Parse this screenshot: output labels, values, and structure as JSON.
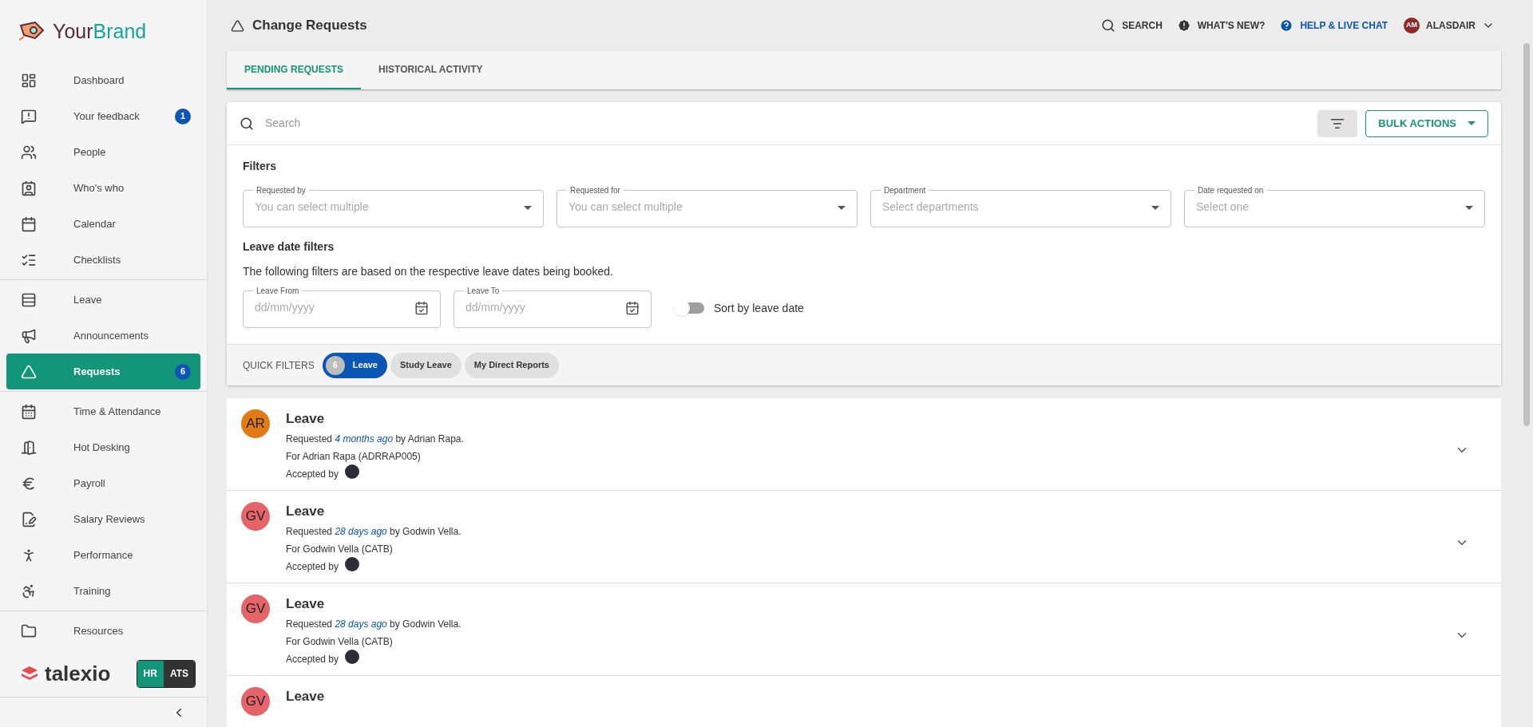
{
  "brand": {
    "prefix": "Your",
    "suffix": "Brand"
  },
  "sidebar": {
    "sections": [
      [
        {
          "label": "Dashboard",
          "selected": false
        },
        {
          "label": "Your feedback",
          "badge": "1",
          "selected": false
        },
        {
          "label": "People",
          "selected": false
        },
        {
          "label": "Who's who",
          "selected": false
        },
        {
          "label": "Calendar",
          "selected": false
        },
        {
          "label": "Checklists",
          "selected": false
        }
      ],
      [
        {
          "label": "Leave",
          "selected": false
        },
        {
          "label": "Announcements",
          "selected": false
        },
        {
          "label": "Requests",
          "badge": "6",
          "selected": true
        }
      ],
      [
        {
          "label": "Time & Attendance",
          "selected": false
        },
        {
          "label": "Hot Desking",
          "selected": false
        },
        {
          "label": "Payroll",
          "selected": false
        },
        {
          "label": "Salary Reviews",
          "selected": false
        },
        {
          "label": "Performance",
          "selected": false
        },
        {
          "label": "Training",
          "selected": false
        }
      ],
      [
        {
          "label": "Resources",
          "selected": false
        }
      ]
    ],
    "footer": {
      "logo": "talexio",
      "switch": [
        {
          "label": "HR",
          "selected": true
        },
        {
          "label": "ATS",
          "selected": false
        }
      ]
    }
  },
  "header": {
    "title": "Change Requests",
    "actions": [
      {
        "label": "SEARCH"
      },
      {
        "label": "WHAT'S NEW?"
      },
      {
        "label": "HELP & LIVE CHAT"
      }
    ],
    "user": {
      "initials": "AM",
      "name": "ALASDAIR"
    }
  },
  "tabs": [
    {
      "label": "PENDING REQUESTS",
      "selected": true
    },
    {
      "label": "HISTORICAL ACTIVITY",
      "selected": false
    }
  ],
  "search": {
    "placeholder": "Search",
    "bulk_actions": "BULK ACTIONS"
  },
  "filters": {
    "title": "Filters",
    "selects": [
      {
        "label": "Requested by",
        "placeholder": "You can select multiple"
      },
      {
        "label": "Requested for",
        "placeholder": "You can select multiple"
      },
      {
        "label": "Department",
        "placeholder": "Select departments"
      },
      {
        "label": "Date requested on",
        "placeholder": "Select one"
      }
    ],
    "leave_title": "Leave date filters",
    "leave_note": "The following filters are based on the respective leave dates being booked.",
    "dates": [
      {
        "label": "Leave From",
        "placeholder": "dd/mm/yyyy"
      },
      {
        "label": "Leave To",
        "placeholder": "dd/mm/yyyy"
      }
    ],
    "sort_toggle": {
      "label": "Sort by leave date",
      "on": false
    }
  },
  "quick_filters": {
    "label": "QUICK FILTERS",
    "chips": [
      {
        "label": "Leave",
        "count": "6",
        "selected": true
      },
      {
        "label": "Study Leave",
        "selected": false
      },
      {
        "label": "My Direct Reports",
        "selected": false
      }
    ]
  },
  "requests": [
    {
      "initials": "AR",
      "color": "#e07b16",
      "title": "Leave",
      "requested": "Requested *4 months ago* by Adrian Rapa.",
      "for": "For Adrian Rapa (ADRRAP005)",
      "accepted": "Accepted by"
    },
    {
      "initials": "GV",
      "color": "#e5646a",
      "title": "Leave",
      "requested": "Requested *28 days ago* by Godwin Vella.",
      "for": "For Godwin Vella (CATB)",
      "accepted": "Accepted by"
    },
    {
      "initials": "GV",
      "color": "#e5646a",
      "title": "Leave",
      "requested": "Requested *28 days ago* by Godwin Vella.",
      "for": "For Godwin Vella (CATB)",
      "accepted": "Accepted by"
    },
    {
      "initials": "GV",
      "color": "#e5646a",
      "title": "Leave"
    }
  ]
}
